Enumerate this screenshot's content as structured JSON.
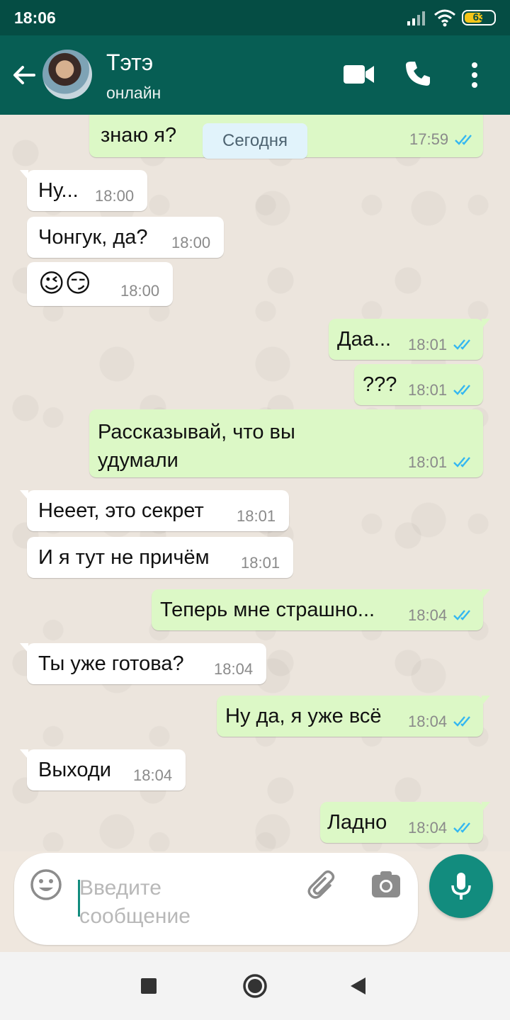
{
  "status_bar": {
    "time": "18:06",
    "battery": "63",
    "battery_level": 0.63
  },
  "header": {
    "contact_name": "Тэтэ",
    "contact_status": "онлайн"
  },
  "chat": {
    "date_separator": "Сегодня",
    "top_partial": {
      "text": "ты знаешь что-то чего не знаю я?",
      "time": "17:59",
      "read": true
    },
    "messages": [
      {
        "dir": "in",
        "text": "Ну...",
        "time": "18:00"
      },
      {
        "dir": "in",
        "text": "Чонгук, да?",
        "time": "18:00"
      },
      {
        "dir": "in",
        "text": "😉😏",
        "time": "18:00"
      },
      {
        "dir": "out",
        "text": "Даа...",
        "time": "18:01",
        "read": true
      },
      {
        "dir": "out",
        "text": "???",
        "time": "18:01",
        "read": true
      },
      {
        "dir": "out",
        "text": "Рассказывай, что вы удумали",
        "time": "18:01",
        "read": true
      },
      {
        "dir": "in",
        "text": "Нееет, это секрет",
        "time": "18:01"
      },
      {
        "dir": "in",
        "text": "И я тут не причём",
        "time": "18:01"
      },
      {
        "dir": "out",
        "text": "Теперь мне страшно...",
        "time": "18:04",
        "read": true
      },
      {
        "dir": "in",
        "text": "Ты уже готова?",
        "time": "18:04"
      },
      {
        "dir": "out",
        "text": "Ну да, я уже всё",
        "time": "18:04",
        "read": true
      },
      {
        "dir": "in",
        "text": "Выходи",
        "time": "18:04"
      },
      {
        "dir": "out",
        "text": "Ладно",
        "time": "18:04",
        "read": true
      }
    ]
  },
  "composer": {
    "placeholder": "Введите сообщение"
  },
  "icons": {
    "back": "arrow-left-icon",
    "video": "video-call-icon",
    "call": "phone-icon",
    "menu": "more-vert-icon",
    "emoji": "emoji-icon",
    "attach": "paperclip-icon",
    "camera": "camera-icon",
    "mic": "mic-icon"
  },
  "colors": {
    "header": "#075e54",
    "status_bar": "#054d44",
    "outgoing": "#dcf8c6",
    "incoming": "#ffffff",
    "accent": "#128c7e",
    "read_ticks": "#34b7f1"
  }
}
